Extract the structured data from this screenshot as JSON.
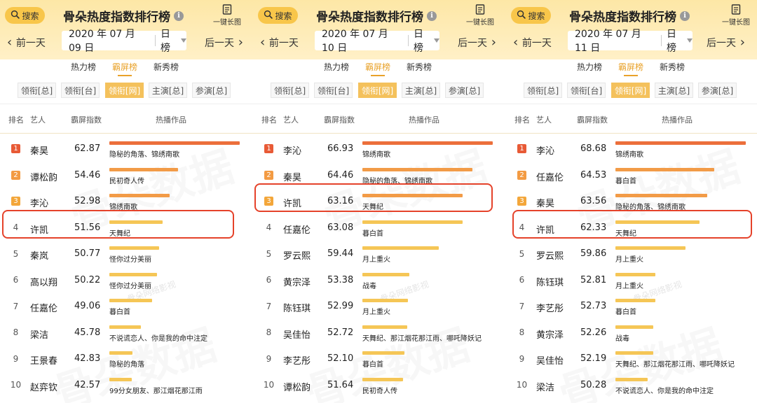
{
  "colors": {
    "accent": "#e9a22a",
    "header_bg": "#fde7a6",
    "highlight_box": "#e5422a",
    "rank1": "#e85a36",
    "rank2": "#f39b43",
    "rank3": "#f3a63a",
    "bar_top": "#ec6f3b",
    "bar_mid": "#f29b47",
    "bar_normal": "#f5c656"
  },
  "common": {
    "search_label": "搜索",
    "title": "骨朵热度指数排行榜",
    "info_icon": "i",
    "long_image_label": "一键长图",
    "prev_label": "前一天",
    "next_label": "后一天",
    "board_type": "日榜",
    "tabs": [
      "热力榜",
      "霸屏榜",
      "新秀榜"
    ],
    "active_tab": 1,
    "subtabs": [
      "领衔[总]",
      "领衔[台]",
      "领衔[网]",
      "主演[总]",
      "参演[总]"
    ],
    "active_subtab": 2,
    "columns": [
      "排名",
      "艺人",
      "霸屏指数",
      "热播作品"
    ],
    "watermark": "骨朵数据",
    "watermark_small": "骨朵网络影视"
  },
  "panels": [
    {
      "date": "2020 年 07 月 09 日",
      "highlight_row": 4,
      "rows": [
        {
          "rank": "1",
          "artist": "秦昊",
          "score": 62.87,
          "works": "隐秘的角落、锦绣南歌"
        },
        {
          "rank": "2",
          "artist": "谭松韵",
          "score": 54.46,
          "works": "民初奇人传"
        },
        {
          "rank": "3",
          "artist": "李沁",
          "score": 52.98,
          "works": "锦绣南歌"
        },
        {
          "rank": "4",
          "artist": "许凯",
          "score": 51.56,
          "works": "天舞纪"
        },
        {
          "rank": "5",
          "artist": "秦岚",
          "score": 50.77,
          "works": "怪你过分美丽"
        },
        {
          "rank": "6",
          "artist": "高以翔",
          "score": 50.22,
          "works": "怪你过分美丽"
        },
        {
          "rank": "7",
          "artist": "任嘉伦",
          "score": 49.06,
          "works": "暮白首"
        },
        {
          "rank": "8",
          "artist": "梁洁",
          "score": 45.78,
          "works": "不说谎恋人、你是我的命中注定"
        },
        {
          "rank": "9",
          "artist": "王景春",
          "score": 42.83,
          "works": "隐秘的角落"
        },
        {
          "rank": "10",
          "artist": "赵弈钦",
          "score": 42.57,
          "works": "99分女朋友、那江烟花那江雨"
        }
      ]
    },
    {
      "date": "2020 年 07 月 10 日",
      "highlight_row": 3,
      "rows": [
        {
          "rank": "1",
          "artist": "李沁",
          "score": 66.93,
          "works": "锦绣南歌"
        },
        {
          "rank": "2",
          "artist": "秦昊",
          "score": 64.46,
          "works": "隐秘的角落、锦绣南歌"
        },
        {
          "rank": "3",
          "artist": "许凯",
          "score": 63.16,
          "works": "天舞纪"
        },
        {
          "rank": "4",
          "artist": "任嘉伦",
          "score": 63.08,
          "works": "暮白首"
        },
        {
          "rank": "5",
          "artist": "罗云熙",
          "score": 59.44,
          "works": "月上重火"
        },
        {
          "rank": "6",
          "artist": "黄宗泽",
          "score": 53.38,
          "works": "战毒"
        },
        {
          "rank": "7",
          "artist": "陈钰琪",
          "score": 52.99,
          "works": "月上重火"
        },
        {
          "rank": "8",
          "artist": "吴佳怡",
          "score": 52.72,
          "works": "天舞纪、那江烟花那江雨、哪吒降妖记"
        },
        {
          "rank": "9",
          "artist": "李艺彤",
          "score": 52.1,
          "works": "暮白首"
        },
        {
          "rank": "10",
          "artist": "谭松韵",
          "score": 51.64,
          "works": "民初奇人传"
        }
      ]
    },
    {
      "date": "2020 年 07 月 11 日",
      "highlight_row": 4,
      "rows": [
        {
          "rank": "1",
          "artist": "李沁",
          "score": 68.68,
          "works": "锦绣南歌"
        },
        {
          "rank": "2",
          "artist": "任嘉伦",
          "score": 64.53,
          "works": "暮白首"
        },
        {
          "rank": "3",
          "artist": "秦昊",
          "score": 63.56,
          "works": "隐秘的角落、锦绣南歌"
        },
        {
          "rank": "4",
          "artist": "许凯",
          "score": 62.33,
          "works": "天舞纪"
        },
        {
          "rank": "5",
          "artist": "罗云熙",
          "score": 59.86,
          "works": "月上重火"
        },
        {
          "rank": "6",
          "artist": "陈钰琪",
          "score": 52.81,
          "works": "月上重火"
        },
        {
          "rank": "7",
          "artist": "李艺彤",
          "score": 52.73,
          "works": "暮白首"
        },
        {
          "rank": "8",
          "artist": "黄宗泽",
          "score": 52.26,
          "works": "战毒"
        },
        {
          "rank": "9",
          "artist": "吴佳怡",
          "score": 52.19,
          "works": "天舞纪、那江烟花那江雨、哪吒降妖记"
        },
        {
          "rank": "10",
          "artist": "梁洁",
          "score": 50.28,
          "works": "不说谎恋人、你是我的命中注定"
        }
      ]
    }
  ]
}
